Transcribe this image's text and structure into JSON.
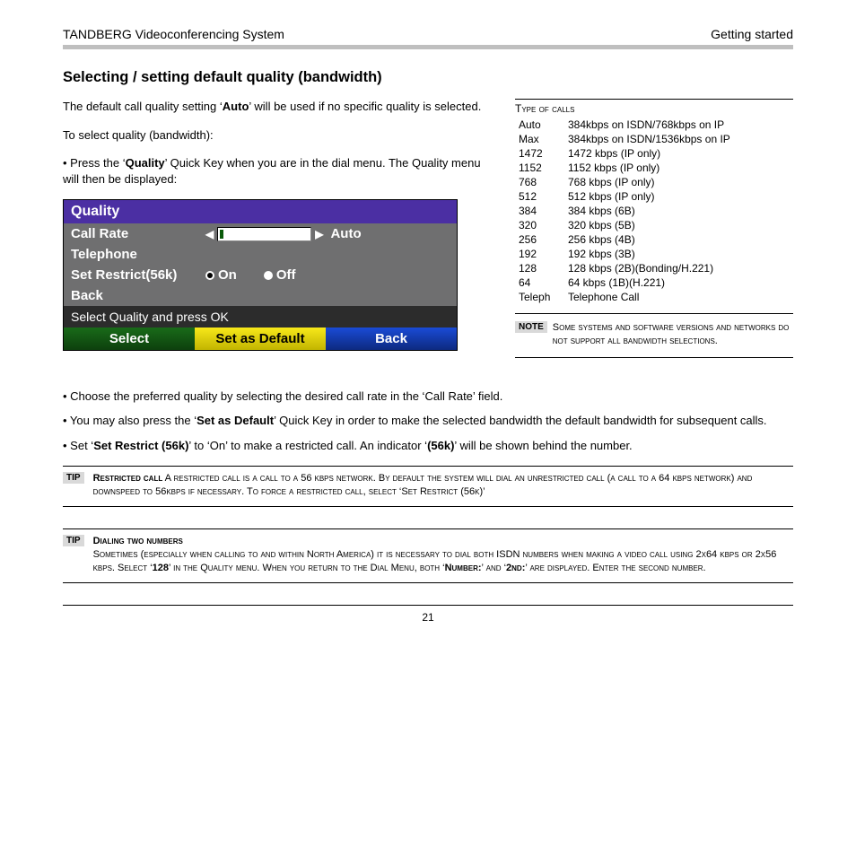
{
  "header": {
    "left": "TANDBERG Videoconferencing System",
    "right": "Getting started"
  },
  "title": "Selecting / setting default quality (bandwidth)",
  "intro1_a": "The default call quality setting ‘",
  "intro1_b": "Auto",
  "intro1_c": "’ will be used if no specific quality is selected.",
  "intro2": "To select quality (bandwidth):",
  "intro3_a": "• Press the ‘",
  "intro3_b": "Quality",
  "intro3_c": "’ Quick Key when you are in the dial menu. The Quality menu will then be displayed:",
  "menu": {
    "title": "Quality",
    "callrate": "Call Rate",
    "callrate_value": "Auto",
    "telephone": "Telephone",
    "restrict": "Set Restrict(56k)",
    "on": "On",
    "off": "Off",
    "back": "Back",
    "help": "Select Quality and press OK",
    "sk_select": "Select",
    "sk_default": "Set as Default",
    "sk_back": "Back"
  },
  "table_title": "Type of calls",
  "rates": [
    {
      "k": "Auto",
      "v": "384kbps on ISDN/768kbps on IP"
    },
    {
      "k": "Max",
      "v": "384kbps on ISDN/1536kbps on IP"
    },
    {
      "k": "1472",
      "v": "1472 kbps (IP only)"
    },
    {
      "k": "1152",
      "v": "1152 kbps (IP only)"
    },
    {
      "k": "768",
      "v": "768 kbps (IP only)"
    },
    {
      "k": "512",
      "v": "512 kbps (IP only)"
    },
    {
      "k": "384",
      "v": "384 kbps (6B)"
    },
    {
      "k": "320",
      "v": "320 kbps (5B)"
    },
    {
      "k": "256",
      "v": "256 kbps (4B)"
    },
    {
      "k": "192",
      "v": "192 kbps (3B)"
    },
    {
      "k": "128",
      "v": "128 kbps (2B)(Bonding/H.221)"
    },
    {
      "k": "64",
      "v": "64 kbps (1B)(H.221)"
    },
    {
      "k": "Teleph",
      "v": "Telephone Call"
    }
  ],
  "note_label": "NOTE",
  "note_text": "Some systems and software versions and networks do not support all bandwidth selections.",
  "bul1": "• Choose the preferred quality by selecting the desired call rate in the ‘Call Rate’ field.",
  "bul2_a": "• You may also press the ‘",
  "bul2_b": "Set as Default",
  "bul2_c": "’ Quick Key in order to make the selected bandwidth the default bandwidth for subsequent calls.",
  "bul3_a": "• Set ‘",
  "bul3_b": "Set Restrict (56k)",
  "bul3_c": "’ to ‘On’ to make a restricted call. An indicator ‘",
  "bul3_d": "(56k)",
  "bul3_e": "’ will be shown behind the number.",
  "tip_label": "TIP",
  "tip1_title": "Restricted call",
  "tip1_body": " A restricted call is a call to a 56 kbps network. By default the system will dial an unrestricted call (a call to a 64 kbps network) and downspeed to 56kbps if necessary. To force a restricted call, select ‘Set Restrict (56k)’",
  "tip2_title": "Dialing two numbers",
  "tip2_body_a": "Sometimes (especially when calling to and within North America) it is necessary to dial both ISDN numbers when making a video call using 2x64 kbps or 2x56 kbps. Select ‘",
  "tip2_body_b": "128",
  "tip2_body_c": "’ in the Quality menu. When you return to the Dial Menu, both ‘",
  "tip2_body_d": "Number:",
  "tip2_body_e": "’ and ‘",
  "tip2_body_f": "2nd:",
  "tip2_body_g": "’ are displayed. Enter the second number.",
  "page_number": "21"
}
